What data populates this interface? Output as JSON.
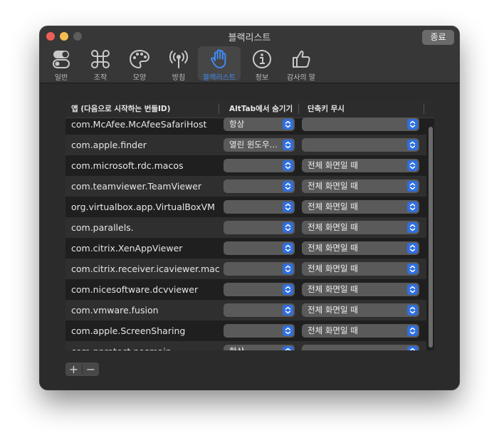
{
  "window": {
    "title": "블랙리스트",
    "quit_label": "종료"
  },
  "tabs": [
    {
      "label": "일반",
      "icon": "toggle-icon"
    },
    {
      "label": "조작",
      "icon": "command-icon"
    },
    {
      "label": "모양",
      "icon": "palette-icon"
    },
    {
      "label": "방침",
      "icon": "antenna-icon"
    },
    {
      "label": "블랙리스트",
      "icon": "hand-icon",
      "active": true
    },
    {
      "label": "정보",
      "icon": "info-icon"
    },
    {
      "label": "감사의 말",
      "icon": "thumbs-up-icon"
    }
  ],
  "table": {
    "headers": [
      "앱 (다음으로 시작하는 번들ID)",
      "AltTab에서 숨기기",
      "단축키 무시"
    ],
    "rows": [
      {
        "app": "com.McAfee.McAfeeSafariHost",
        "hide": "항상",
        "ignore": ""
      },
      {
        "app": "com.apple.finder",
        "hide": "열린 윈도우…",
        "ignore": ""
      },
      {
        "app": "com.microsoft.rdc.macos",
        "hide": "",
        "ignore": "전체 화면일 때"
      },
      {
        "app": "com.teamviewer.TeamViewer",
        "hide": "",
        "ignore": "전체 화면일 때"
      },
      {
        "app": "org.virtualbox.app.VirtualBoxVM",
        "hide": "",
        "ignore": "전체 화면일 때"
      },
      {
        "app": "com.parallels.",
        "hide": "",
        "ignore": "전체 화면일 때"
      },
      {
        "app": "com.citrix.XenAppViewer",
        "hide": "",
        "ignore": "전체 화면일 때"
      },
      {
        "app": "com.citrix.receiver.icaviewer.mac",
        "hide": "",
        "ignore": "전체 화면일 때"
      },
      {
        "app": "com.nicesoftware.dcvviewer",
        "hide": "",
        "ignore": "전체 화면일 때"
      },
      {
        "app": "com.vmware.fusion",
        "hide": "",
        "ignore": "전체 화면일 때"
      },
      {
        "app": "com.apple.ScreenSharing",
        "hide": "",
        "ignore": "전체 화면일 때"
      },
      {
        "app": "com.nprotect.nosmain",
        "hide": "항상",
        "ignore": ""
      }
    ]
  },
  "buttons": {
    "add": "+",
    "remove": "−"
  },
  "colors": {
    "accent": "#3f8bf3",
    "popup_chevron": "#2f6fe0",
    "close": "#ec5f57",
    "minimize": "#f5bd4f"
  }
}
